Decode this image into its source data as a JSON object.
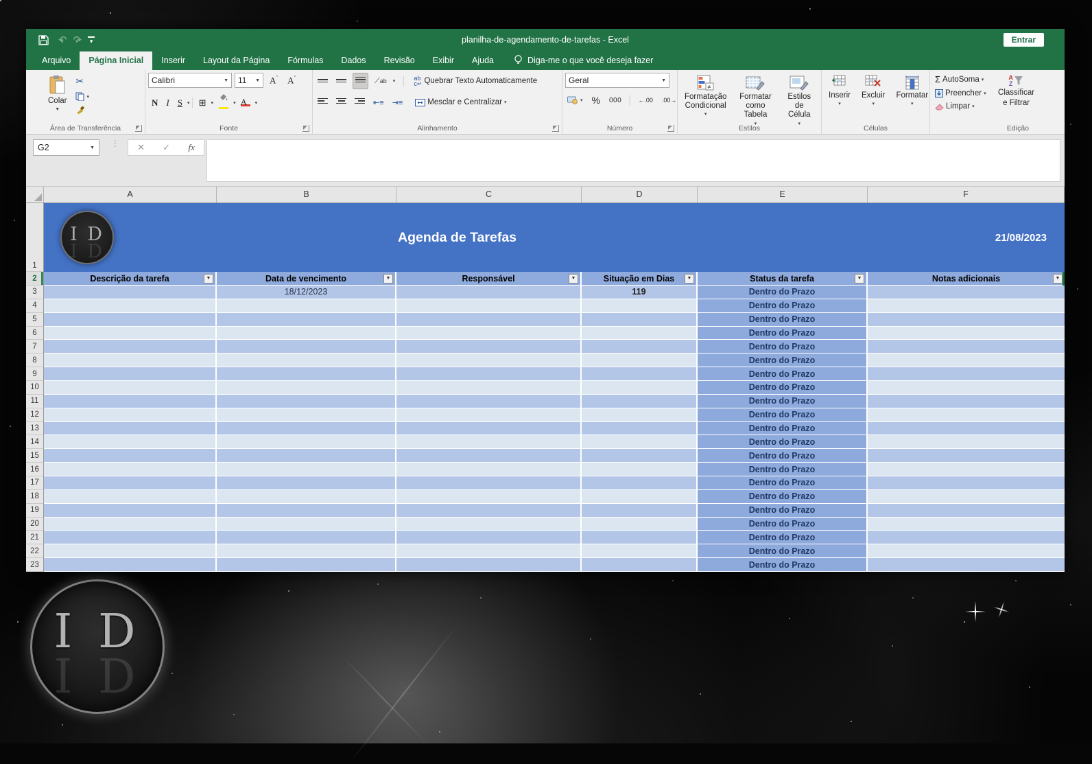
{
  "window": {
    "title": "planilha-de-agendamento-de-tarefas  -  Excel",
    "signin": "Entrar"
  },
  "tabs": [
    "Arquivo",
    "Página Inicial",
    "Inserir",
    "Layout da Página",
    "Fórmulas",
    "Dados",
    "Revisão",
    "Exibir",
    "Ajuda"
  ],
  "active_tab_index": 1,
  "tellme": "Diga-me o que você deseja fazer",
  "ribbon": {
    "clipboard": {
      "paste": "Colar",
      "group": "Área de Transferência"
    },
    "font": {
      "family": "Calibri",
      "size": "11",
      "bold": "N",
      "italic": "I",
      "underline": "S",
      "group": "Fonte"
    },
    "alignment": {
      "wrap": "Quebrar Texto Automaticamente",
      "merge": "Mesclar e Centralizar",
      "group": "Alinhamento"
    },
    "number": {
      "format": "Geral",
      "percent": "%",
      "thousands": "000",
      "inc_decimal": "←.00",
      "dec_decimal": ".00→",
      "group": "Número"
    },
    "styles": {
      "conditional": "Formatação Condicional",
      "table": "Formatar como Tabela",
      "cell": "Estilos de Célula",
      "group": "Estilos"
    },
    "cells": {
      "insert": "Inserir",
      "delete": "Excluir",
      "format": "Formatar",
      "group": "Células"
    },
    "editing": {
      "autosum": "AutoSoma",
      "fill": "Preencher",
      "clear": "Limpar",
      "sort_line1": "Classificar",
      "sort_line2": "e Filtrar",
      "group": "Edição"
    }
  },
  "formula_bar": {
    "name_box": "G2",
    "cancel": "✕",
    "enter": "✓",
    "fx": "fx"
  },
  "sheet": {
    "columns": [
      "A",
      "B",
      "C",
      "D",
      "E",
      "F"
    ],
    "banner": {
      "row_num": "1",
      "logo": "I D",
      "title": "Agenda de Tarefas",
      "date": "21/08/2023"
    },
    "header_row_num": "2",
    "headers": [
      "Descrição da tarefa",
      "Data de vencimento",
      "Responsável",
      "Situação em Dias",
      "Status da tarefa",
      "Notas adicionais"
    ],
    "rows": [
      {
        "n": "3",
        "desc": "",
        "due": "18/12/2023",
        "resp": "",
        "days": "119",
        "status": "Dentro do Prazo",
        "notes": ""
      },
      {
        "n": "4",
        "desc": "",
        "due": "",
        "resp": "",
        "days": "",
        "status": "Dentro do Prazo",
        "notes": ""
      },
      {
        "n": "5",
        "desc": "",
        "due": "",
        "resp": "",
        "days": "",
        "status": "Dentro do Prazo",
        "notes": ""
      },
      {
        "n": "6",
        "desc": "",
        "due": "",
        "resp": "",
        "days": "",
        "status": "Dentro do Prazo",
        "notes": ""
      },
      {
        "n": "7",
        "desc": "",
        "due": "",
        "resp": "",
        "days": "",
        "status": "Dentro do Prazo",
        "notes": ""
      },
      {
        "n": "8",
        "desc": "",
        "due": "",
        "resp": "",
        "days": "",
        "status": "Dentro do Prazo",
        "notes": ""
      },
      {
        "n": "9",
        "desc": "",
        "due": "",
        "resp": "",
        "days": "",
        "status": "Dentro do Prazo",
        "notes": ""
      },
      {
        "n": "10",
        "desc": "",
        "due": "",
        "resp": "",
        "days": "",
        "status": "Dentro do Prazo",
        "notes": ""
      },
      {
        "n": "11",
        "desc": "",
        "due": "",
        "resp": "",
        "days": "",
        "status": "Dentro do Prazo",
        "notes": ""
      },
      {
        "n": "12",
        "desc": "",
        "due": "",
        "resp": "",
        "days": "",
        "status": "Dentro do Prazo",
        "notes": ""
      },
      {
        "n": "13",
        "desc": "",
        "due": "",
        "resp": "",
        "days": "",
        "status": "Dentro do Prazo",
        "notes": ""
      },
      {
        "n": "14",
        "desc": "",
        "due": "",
        "resp": "",
        "days": "",
        "status": "Dentro do Prazo",
        "notes": ""
      },
      {
        "n": "15",
        "desc": "",
        "due": "",
        "resp": "",
        "days": "",
        "status": "Dentro do Prazo",
        "notes": ""
      },
      {
        "n": "16",
        "desc": "",
        "due": "",
        "resp": "",
        "days": "",
        "status": "Dentro do Prazo",
        "notes": ""
      },
      {
        "n": "17",
        "desc": "",
        "due": "",
        "resp": "",
        "days": "",
        "status": "Dentro do Prazo",
        "notes": ""
      },
      {
        "n": "18",
        "desc": "",
        "due": "",
        "resp": "",
        "days": "",
        "status": "Dentro do Prazo",
        "notes": ""
      },
      {
        "n": "19",
        "desc": "",
        "due": "",
        "resp": "",
        "days": "",
        "status": "Dentro do Prazo",
        "notes": ""
      },
      {
        "n": "20",
        "desc": "",
        "due": "",
        "resp": "",
        "days": "",
        "status": "Dentro do Prazo",
        "notes": ""
      },
      {
        "n": "21",
        "desc": "",
        "due": "",
        "resp": "",
        "days": "",
        "status": "Dentro do Prazo",
        "notes": ""
      },
      {
        "n": "22",
        "desc": "",
        "due": "",
        "resp": "",
        "days": "",
        "status": "Dentro do Prazo",
        "notes": ""
      },
      {
        "n": "23",
        "desc": "",
        "due": "",
        "resp": "",
        "days": "",
        "status": "Dentro do Prazo",
        "notes": ""
      }
    ]
  },
  "watermark": {
    "logo": "I D"
  },
  "colors": {
    "excel_green": "#217346",
    "banner_blue": "#4472C4",
    "header_blue": "#8FAADC",
    "band_dark": "#B4C6E7",
    "band_light": "#DCE6F1",
    "status_text": "#1F3864"
  }
}
